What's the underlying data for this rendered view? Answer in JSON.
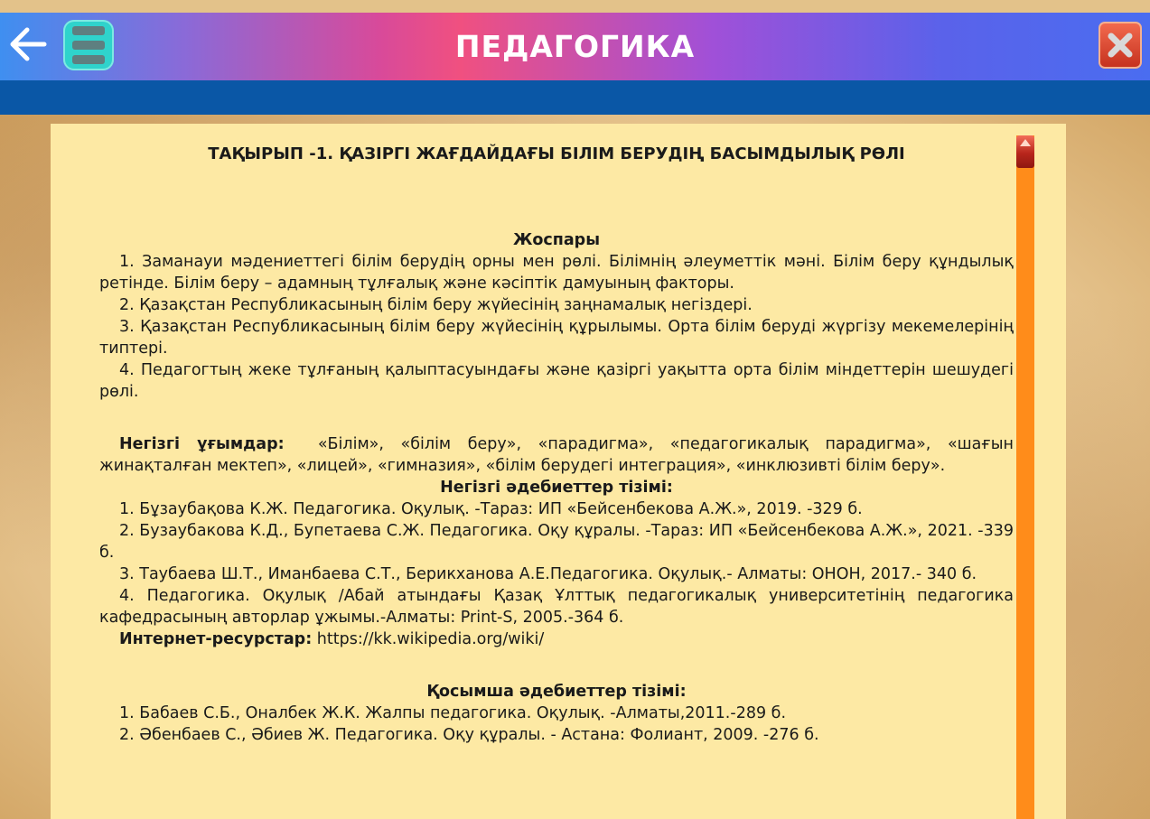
{
  "header": {
    "title": "ПЕДАГОГИКА"
  },
  "document": {
    "title": "ТАҚЫРЫП -1. ҚАЗІРГІ ЖАҒДАЙДАҒЫ БІЛІМ БЕРУДІҢ БАСЫМДЫЛЫҚ РӨЛІ",
    "plan_heading": "Жоспары",
    "plan_items": [
      "1. Заманауи мәдениеттегі білім берудің орны мен рөлі. Білімнің әлеуметтік мәні. Білім беру құндылық ретінде. Білім беру – адамның тұлғалық және кәсіптік дамуының факторы.",
      "2. Қазақстан Республикасының білім беру жүйесінің заңнамалық негіздері.",
      "3. Қазақстан Республикасының білім беру жүйесінің құрылымы. Орта білім беруді жүргізу мекемелерінің типтері.",
      "4. Педагогтың жеке тұлғаның қалыптасуындағы және қазіргі уақытта орта білім міндеттерін шешудегі рөлі."
    ],
    "concepts_label": "Негізгі ұғымдар:",
    "concepts_text": "«Білім», «білім беру», «парадигма», «педагогикалық парадигма», «шағын жинақталған мектеп», «лицей», «гимназия», «білім берудегі интеграция», «инклюзивті білім беру».",
    "main_lit_heading": "Негізгі әдебиеттер тізімі:",
    "main_lit": [
      "1. Бұзаубақова К.Ж. Педагогика. Оқулық. -Тараз: ИП «Бейсенбекова А.Ж.», 2019. -329 б.",
      "2. Бузаубакова К.Д., Бупетаева С.Ж. Педагогика. Оқу құралы. -Тараз: ИП «Бейсенбекова А.Ж.», 2021. -339 б.",
      "3. Таубаева Ш.Т., Иманбаева С.Т., Берикханова А.Е.Педагогика. Оқулық.- Алматы: ОНОН, 2017.- 340 б.",
      "4. Педагогика. Оқулық /Абай атындағы Қазақ Ұлттық педагогикалық университетінің педагогика кафедрасының авторлар ұжымы.-Алматы: Print-S, 2005.-364 б."
    ],
    "internet_label": "Интернет-ресурстар:",
    "internet_url": "https://kk.wikipedia.org/wiki/",
    "extra_lit_heading": "Қосымша әдебиеттер тізімі:",
    "extra_lit": [
      "1. Бабаев С.Б., Оналбек Ж.К. Жалпы педагогика. Оқулық. -Алматы,2011.-289 б.",
      "2. Әбенбаев С., Әбиев Ж. Педагогика. Оқу құралы. - Астана: Фолиант, 2009. -276 б."
    ]
  },
  "icons": {
    "back": "arrow-left-icon",
    "menu": "hamburger-menu-icon",
    "close": "close-x-icon",
    "scroll_up": "arrow-up-icon"
  },
  "colors": {
    "subbar": "#0a57a6",
    "panel": "#fde9a4",
    "scrollbar": "#ff8c1a",
    "close_button": "#d23c26",
    "menu_button": "#2fd3cc"
  },
  "scroll_position": 0
}
